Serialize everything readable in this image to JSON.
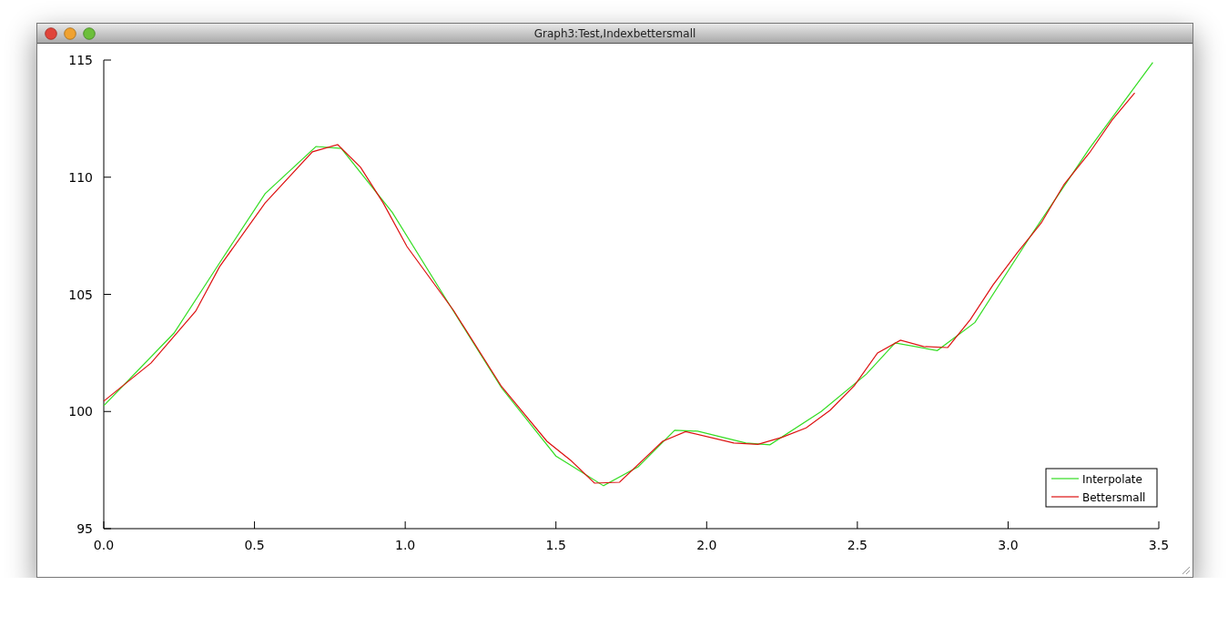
{
  "window": {
    "title": "Graph3:Test,Indexbettersmall"
  },
  "chart_data": {
    "type": "line",
    "xlim": [
      0,
      3.5
    ],
    "ylim": [
      95,
      115
    ],
    "legend": true,
    "xticks": [
      {
        "value": 0,
        "label": "0.0"
      },
      {
        "value": 0.5,
        "label": "0.5"
      },
      {
        "value": 1,
        "label": "1.0"
      },
      {
        "value": 1.5,
        "label": "1.5"
      },
      {
        "value": 2,
        "label": "2.0"
      },
      {
        "value": 2.5,
        "label": "2.5"
      },
      {
        "value": 3,
        "label": "3.0"
      },
      {
        "value": 3.5,
        "label": "3.5"
      }
    ],
    "yticks": [
      {
        "value": 95,
        "label": "95"
      },
      {
        "value": 100,
        "label": "100"
      },
      {
        "value": 105,
        "label": "105"
      },
      {
        "value": 110,
        "label": "110"
      },
      {
        "value": 115,
        "label": "115"
      }
    ],
    "series": [
      {
        "name": "Interpolate",
        "color": "#33dd22",
        "x": [
          0,
          0.233,
          0.384,
          0.535,
          0.704,
          0.788,
          0.957,
          1.14,
          1.32,
          1.5,
          1.658,
          1.773,
          1.894,
          1.97,
          2.13,
          2.21,
          2.38,
          2.53,
          2.625,
          2.765,
          2.89,
          3.07,
          3.27,
          3.48
        ],
        "values": [
          100.25,
          103.35,
          106.34,
          109.3,
          111.31,
          111.23,
          108.5,
          104.7,
          101.0,
          98.1,
          96.83,
          97.64,
          99.2,
          99.16,
          98.66,
          98.58,
          100.0,
          101.6,
          102.93,
          102.6,
          103.8,
          107.4,
          111.23,
          114.9
        ]
      },
      {
        "name": "Bettersmall",
        "color": "#dd1111",
        "x": [
          0,
          0.157,
          0.305,
          0.384,
          0.535,
          0.692,
          0.776,
          0.852,
          0.927,
          1.006,
          1.16,
          1.32,
          1.47,
          1.55,
          1.628,
          1.711,
          1.854,
          1.93,
          2.09,
          2.17,
          2.25,
          2.33,
          2.41,
          2.49,
          2.567,
          2.643,
          2.72,
          2.8,
          2.875,
          2.95,
          3.03,
          3.11,
          3.186,
          3.27,
          3.345,
          3.42
        ],
        "values": [
          100.44,
          102.07,
          104.28,
          106.18,
          108.9,
          111.08,
          111.39,
          110.42,
          108.9,
          107.04,
          104.32,
          101.06,
          98.73,
          97.9,
          96.94,
          96.98,
          98.73,
          99.14,
          98.66,
          98.6,
          98.9,
          99.3,
          100.06,
          101.1,
          102.5,
          103.04,
          102.77,
          102.73,
          103.93,
          105.4,
          106.77,
          108.05,
          109.7,
          111.04,
          112.44,
          113.6
        ]
      }
    ]
  }
}
